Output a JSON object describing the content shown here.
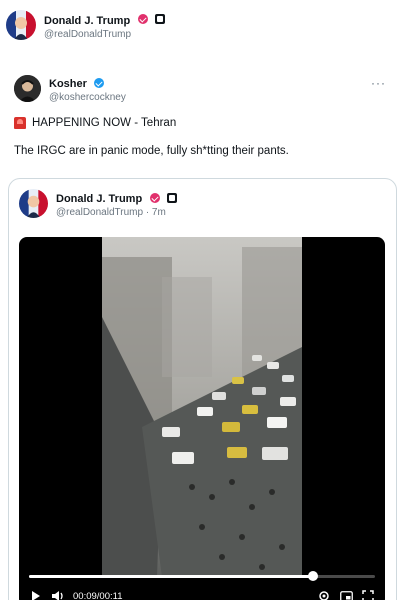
{
  "header": {
    "name": "Donald J. Trump",
    "handle": "@realDonaldTrump"
  },
  "tweet": {
    "author": {
      "name": "Kosher",
      "handle": "@koshercockney"
    },
    "more_label": "···",
    "line1": "HAPPENING NOW - Tehran",
    "line2": "The IRGC are in panic mode, fully sh*tting their pants."
  },
  "quoted": {
    "author": {
      "name": "Donald J. Trump",
      "handle_time": "@realDonaldTrump · 7m"
    },
    "video": {
      "time_label": "00:09/00:11",
      "progress": 0.82
    }
  },
  "colors": {
    "verified_pink": "#e1306c",
    "verified_blue": "#1d9bf0",
    "muted_text": "#6b7680"
  }
}
